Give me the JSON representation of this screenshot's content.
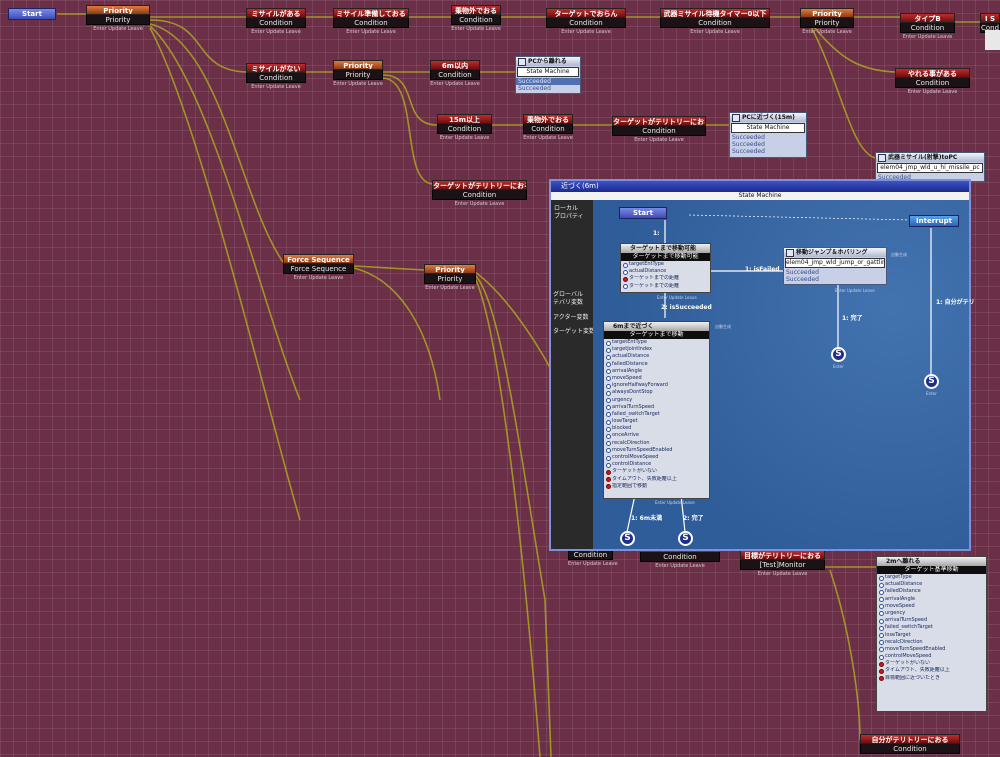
{
  "labels": {
    "condition": "Condition",
    "priority": "Priority",
    "state_machine": "State Machine",
    "footer": "Enter Update Leave",
    "succeeded": "Succeeded",
    "start": "Start"
  },
  "nodes": {
    "start": "Start",
    "priority_1": "Priority",
    "missile_exists": "ミサイルがある",
    "missile_ready": "ミサイル準備しておる",
    "vehicle_outside": "乗物外でおる",
    "no_target": "ターゲットでおらん",
    "timer_below_7": "武器ミサイル待機タイマー0以下",
    "priority_2": "Priority",
    "type_b": "タイプB",
    "s_clip": "I S",
    "missile_absent": "ミサイルがない",
    "priority_3": "Priority",
    "within_6m": "6m以内",
    "pc_fire": "PCから離れる",
    "over_15m": "15m以上",
    "vehicle_outside_2": "乗物外でおる",
    "target_in_territory": "ターゲットがテリトリーにおる",
    "pc_approach": "PCに近づく(15m)",
    "can_move_to_pc": "やれる事がある",
    "missile_pc": "武器ミサイル(射撃)toPC",
    "missile_pc_sub": "elem04_jmp_wld_u_hi_missile_pc",
    "target_in_territory_2": "ターゲットがテリトリーにおる",
    "force_sequence": "Force Sequence",
    "priority_4": "Priority",
    "bottom_condition_1": "Condition",
    "bottom_condition_2": "Condition",
    "territory_monitor_title": "目標がテリトリーにおる",
    "territory_monitor_sub": "[Test]Monitor",
    "move_to_target_title": "2mへ離れる",
    "move_to_target_sub": "ターゲット基準移動",
    "bottom_territory": "自分がテリトリーにおる"
  },
  "overlay": {
    "title": "近づく(6m)",
    "subtitle": "State Machine",
    "left_panel": [
      "ローカル",
      "プロパティ",
      "グローバル",
      "テバリ変数",
      "アクター変数",
      "ターゲット変数"
    ],
    "start": "Start",
    "interrupt": "Interrupt",
    "node_a_title": "ターゲットまで移動可能",
    "node_a_sub": "ターゲットまで移動可能",
    "node_a_items": [
      "targetEntType",
      "actualDistance",
      "ターゲットまでの距離",
      "ターゲットまでの距離"
    ],
    "node_b_title": "6mまで近づく",
    "node_b_sub": "ターゲットまで移動",
    "node_b_items": [
      "targetEntType",
      "targetJointIndex",
      "actualDistance",
      "failedDistance",
      "arrivalAngle",
      "moveSpeed",
      "ignoreHalfwayForward",
      "alwaysDontStop",
      "urgency",
      "arrivalTurnSpeed",
      "failed_switchTarget",
      "loseTarget",
      "blocked",
      "onceArrive",
      "recalcDirection",
      "moveTurnSpeedEnabled",
      "controlMoveSpeed",
      "controlDistance",
      "ターゲットがいない",
      "タイムアウト、失敗距離以上",
      "指定範囲で移動"
    ],
    "node_c_title": "移動ジャンプ＆ホバリング",
    "node_c_sub": "elem04_jmp_wld_jump_or_gattling",
    "edge_fail": "1: isFailed",
    "edge_succeed": "2: isSucceeded",
    "edge_done": "1: 完了",
    "edge_1": "1:",
    "edge_self": "1: 自分がテリ",
    "edge_6m": "1: 6m未満",
    "edge_done2": "2: 完了",
    "s": "S",
    "enter_label": "Enter",
    "auto_label": "自動生成"
  },
  "right_list": {
    "items": [
      "targetType",
      "actualDistance",
      "failedDistance",
      "arrivalAngle",
      "moveSpeed",
      "urgency",
      "arrivalTurnSpeed",
      "failed_switchTarget",
      "loseTarget",
      "recalcDirection",
      "moveTurnSpeedEnabled",
      "controlMoveSpeed",
      "ターゲットがいない",
      "タイムアウト、失敗距離以上",
      "目標範囲に近づいたとき"
    ]
  }
}
